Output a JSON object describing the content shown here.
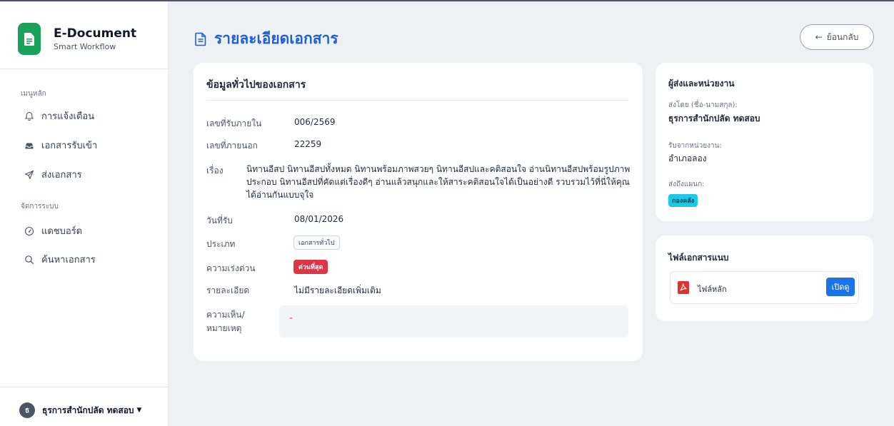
{
  "app": {
    "title": "E-Document",
    "subtitle": "Smart Workflow"
  },
  "sidebar": {
    "section_main": "เมนูหลัก",
    "section_system": "จัดการระบบ",
    "items": [
      {
        "label": "การแจ้งเตือน",
        "icon": "bell-icon"
      },
      {
        "label": "เอกสารรับเข้า",
        "icon": "inbox-icon"
      },
      {
        "label": "ส่งเอกสาร",
        "icon": "send-icon"
      },
      {
        "label": "แดชบอร์ด",
        "icon": "gauge-icon"
      },
      {
        "label": "ค้นหาเอกสาร",
        "icon": "search-icon"
      }
    ],
    "user": {
      "initial": "ธ",
      "name": "ธุรการสำนักปลัด ทดสอบ"
    }
  },
  "header": {
    "title": "รายละเอียดเอกสาร",
    "back_label": "ย้อนกลับ"
  },
  "document": {
    "card_title": "ข้อมูลทั่วไปของเอกสาร",
    "fields": {
      "internal_no_label": "เลขที่รับภายใน",
      "internal_no": "006/2569",
      "external_no_label": "เลขที่ภายนอก",
      "external_no": "22259",
      "subject_label": "เรื่อง",
      "subject": "นิทานอีสป นิทานอีสปทั้งหมด นิทานพร้อมภาพสวยๆ นิทานอีสปและคติสอนใจ อ่านนิทานอีสปพร้อมรูปภาพประกอบ นิทานอีสปที่คัดแต่เรื่องดีๆ อ่านแล้วสนุกและให้สาระคติสอนใจได้เป็นอย่างดี รวบรวมไว้ที่นี่ให้คุณได้อ่านกันแบบจุใจ",
      "received_date_label": "วันที่รับ",
      "received_date": "08/01/2026",
      "type_label": "ประเภท",
      "type": "เอกสารทั่วไป",
      "urgency_label": "ความเร่งด่วน",
      "urgency": "ด่วนที่สุด",
      "detail_label": "รายละเอียด",
      "detail": "ไม่มีรายละเอียดเพิ่มเติม",
      "remark_label_line1": "ความเห็น/",
      "remark_label_line2": "หมายเหตุ",
      "remark": "-"
    }
  },
  "sender": {
    "card_title": "ผู้ส่งและหน่วยงาน",
    "sent_by_label": "ส่งโดย (ชื่อ-นามสกุล):",
    "sent_by": "ธุรการสำนักปลัด ทดสอบ",
    "from_unit_label": "รับจากหน่วยงาน:",
    "from_unit": "อำเภอลอง",
    "to_dept_label": "ส่งถึงแผนก:",
    "to_dept": "กองคลัง"
  },
  "files": {
    "card_title": "ไฟล์เอกสารแนบ",
    "items": [
      {
        "name": "ไฟล์หลัก",
        "open_label": "เปิดดู",
        "icon": "pdf-file-icon"
      }
    ]
  },
  "colors": {
    "accent": "#1d5fd6",
    "brand": "#1aa15a",
    "urgent": "#dc3545",
    "dept_badge": "#1ec8e6",
    "open_button": "#1a73e8"
  }
}
